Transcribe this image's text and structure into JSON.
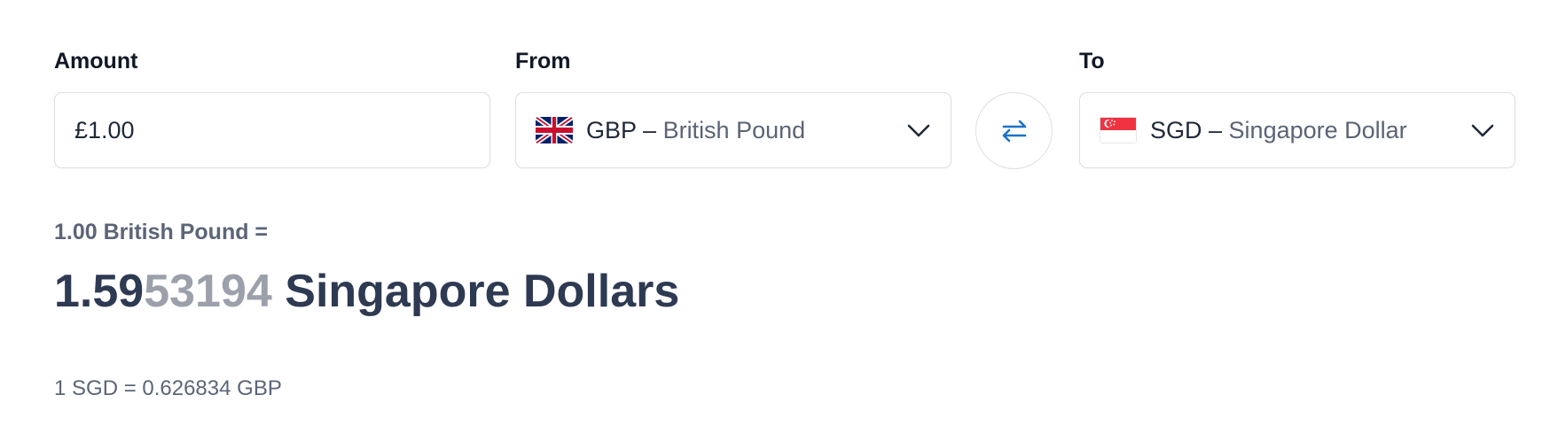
{
  "amount": {
    "label": "Amount",
    "value": "£1.00"
  },
  "from": {
    "label": "From",
    "code": "GBP",
    "separator": " – ",
    "name": "British Pound",
    "flag_icon": "uk-flag-icon"
  },
  "swap": {
    "icon": "swap-arrows-icon",
    "color": "#1a73c8"
  },
  "to": {
    "label": "To",
    "code": "SGD",
    "separator": " – ",
    "name": "Singapore Dollar",
    "flag_icon": "singapore-flag-icon"
  },
  "result": {
    "from_text": "1.00 British Pound =",
    "value_bold": "1.59",
    "value_faded": "53194",
    "to_text": " Singapore Dollars",
    "inverse_rate": "1 SGD = 0.626834 GBP"
  }
}
